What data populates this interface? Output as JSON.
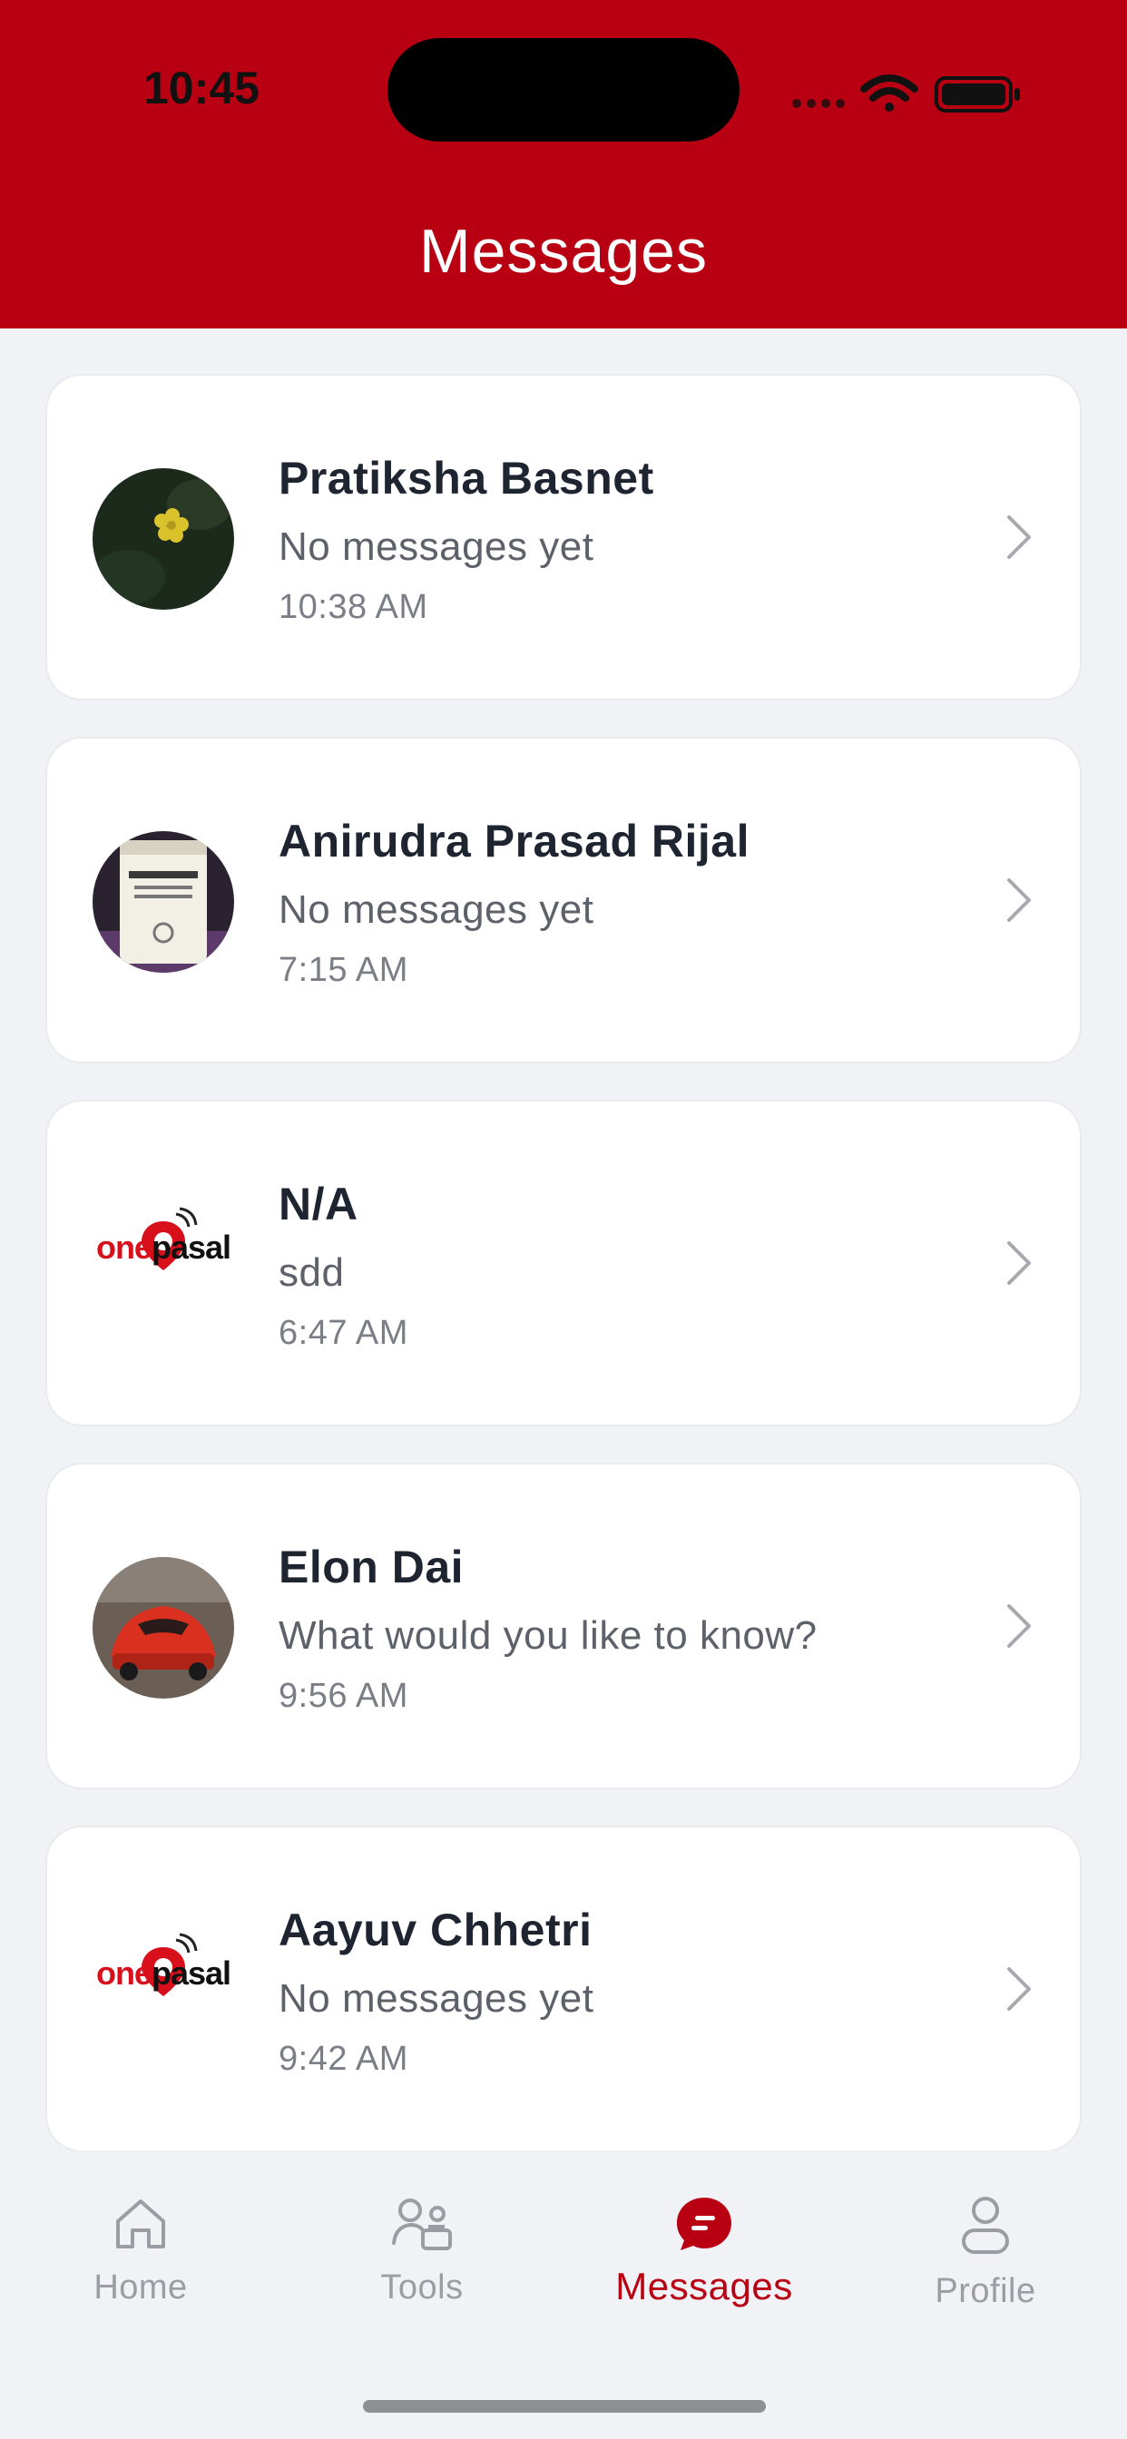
{
  "status_bar": {
    "time": "10:45",
    "icons": [
      "signal-icon",
      "wifi-icon",
      "battery-icon"
    ]
  },
  "header": {
    "title": "Messages"
  },
  "conversations": [
    {
      "name": "Pratiksha Basnet",
      "preview": "No messages yet",
      "time": "10:38 AM",
      "avatar": "flower-photo-avatar"
    },
    {
      "name": "Anirudra Prasad Rijal",
      "preview": "No messages yet",
      "time": "7:15 AM",
      "avatar": "bottle-photo-avatar"
    },
    {
      "name": "N/A",
      "preview": "sdd",
      "time": "6:47 AM",
      "avatar": "onepasal-logo-avatar",
      "logo_text": "onepasal"
    },
    {
      "name": "Elon Dai",
      "preview": "What would you like to know?",
      "time": "9:56 AM",
      "avatar": "car-photo-avatar"
    },
    {
      "name": "Aayuv Chhetri",
      "preview": "No messages yet",
      "time": "9:42 AM",
      "avatar": "onepasal-logo-avatar",
      "logo_text": "onepasal"
    }
  ],
  "tabbar": {
    "tabs": [
      {
        "label": "Home",
        "icon": "home-icon",
        "active": false
      },
      {
        "label": "Tools",
        "icon": "tools-icon",
        "active": false
      },
      {
        "label": "Messages",
        "icon": "messages-icon",
        "active": true
      },
      {
        "label": "Profile",
        "icon": "profile-icon",
        "active": false
      }
    ]
  },
  "colors": {
    "brand": "#b80012",
    "background": "#f1f2f6",
    "name_text": "#1e2430",
    "secondary_text": "#5d616a",
    "inactive_tab": "#9a9da3"
  }
}
